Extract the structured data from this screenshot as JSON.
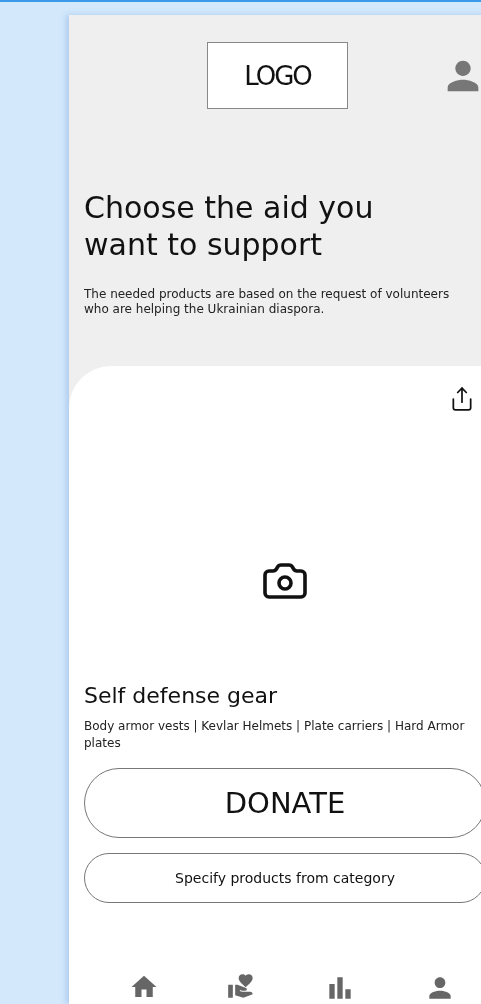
{
  "header": {
    "logo": "LOGO"
  },
  "intro": {
    "title": "Choose the aid you want to support",
    "subtitle": "The needed products are based on the request of volunteers who are helping the Ukrainian diaspora."
  },
  "card": {
    "name": "Self defense gear",
    "items": "Body armor vests | Kevlar Helmets | Plate carriers | Hard Armor plates",
    "buttons": [
      {
        "kind": "primary",
        "label": "DONATE"
      },
      {
        "kind": "secondary",
        "label": "Specify products from category"
      }
    ]
  }
}
